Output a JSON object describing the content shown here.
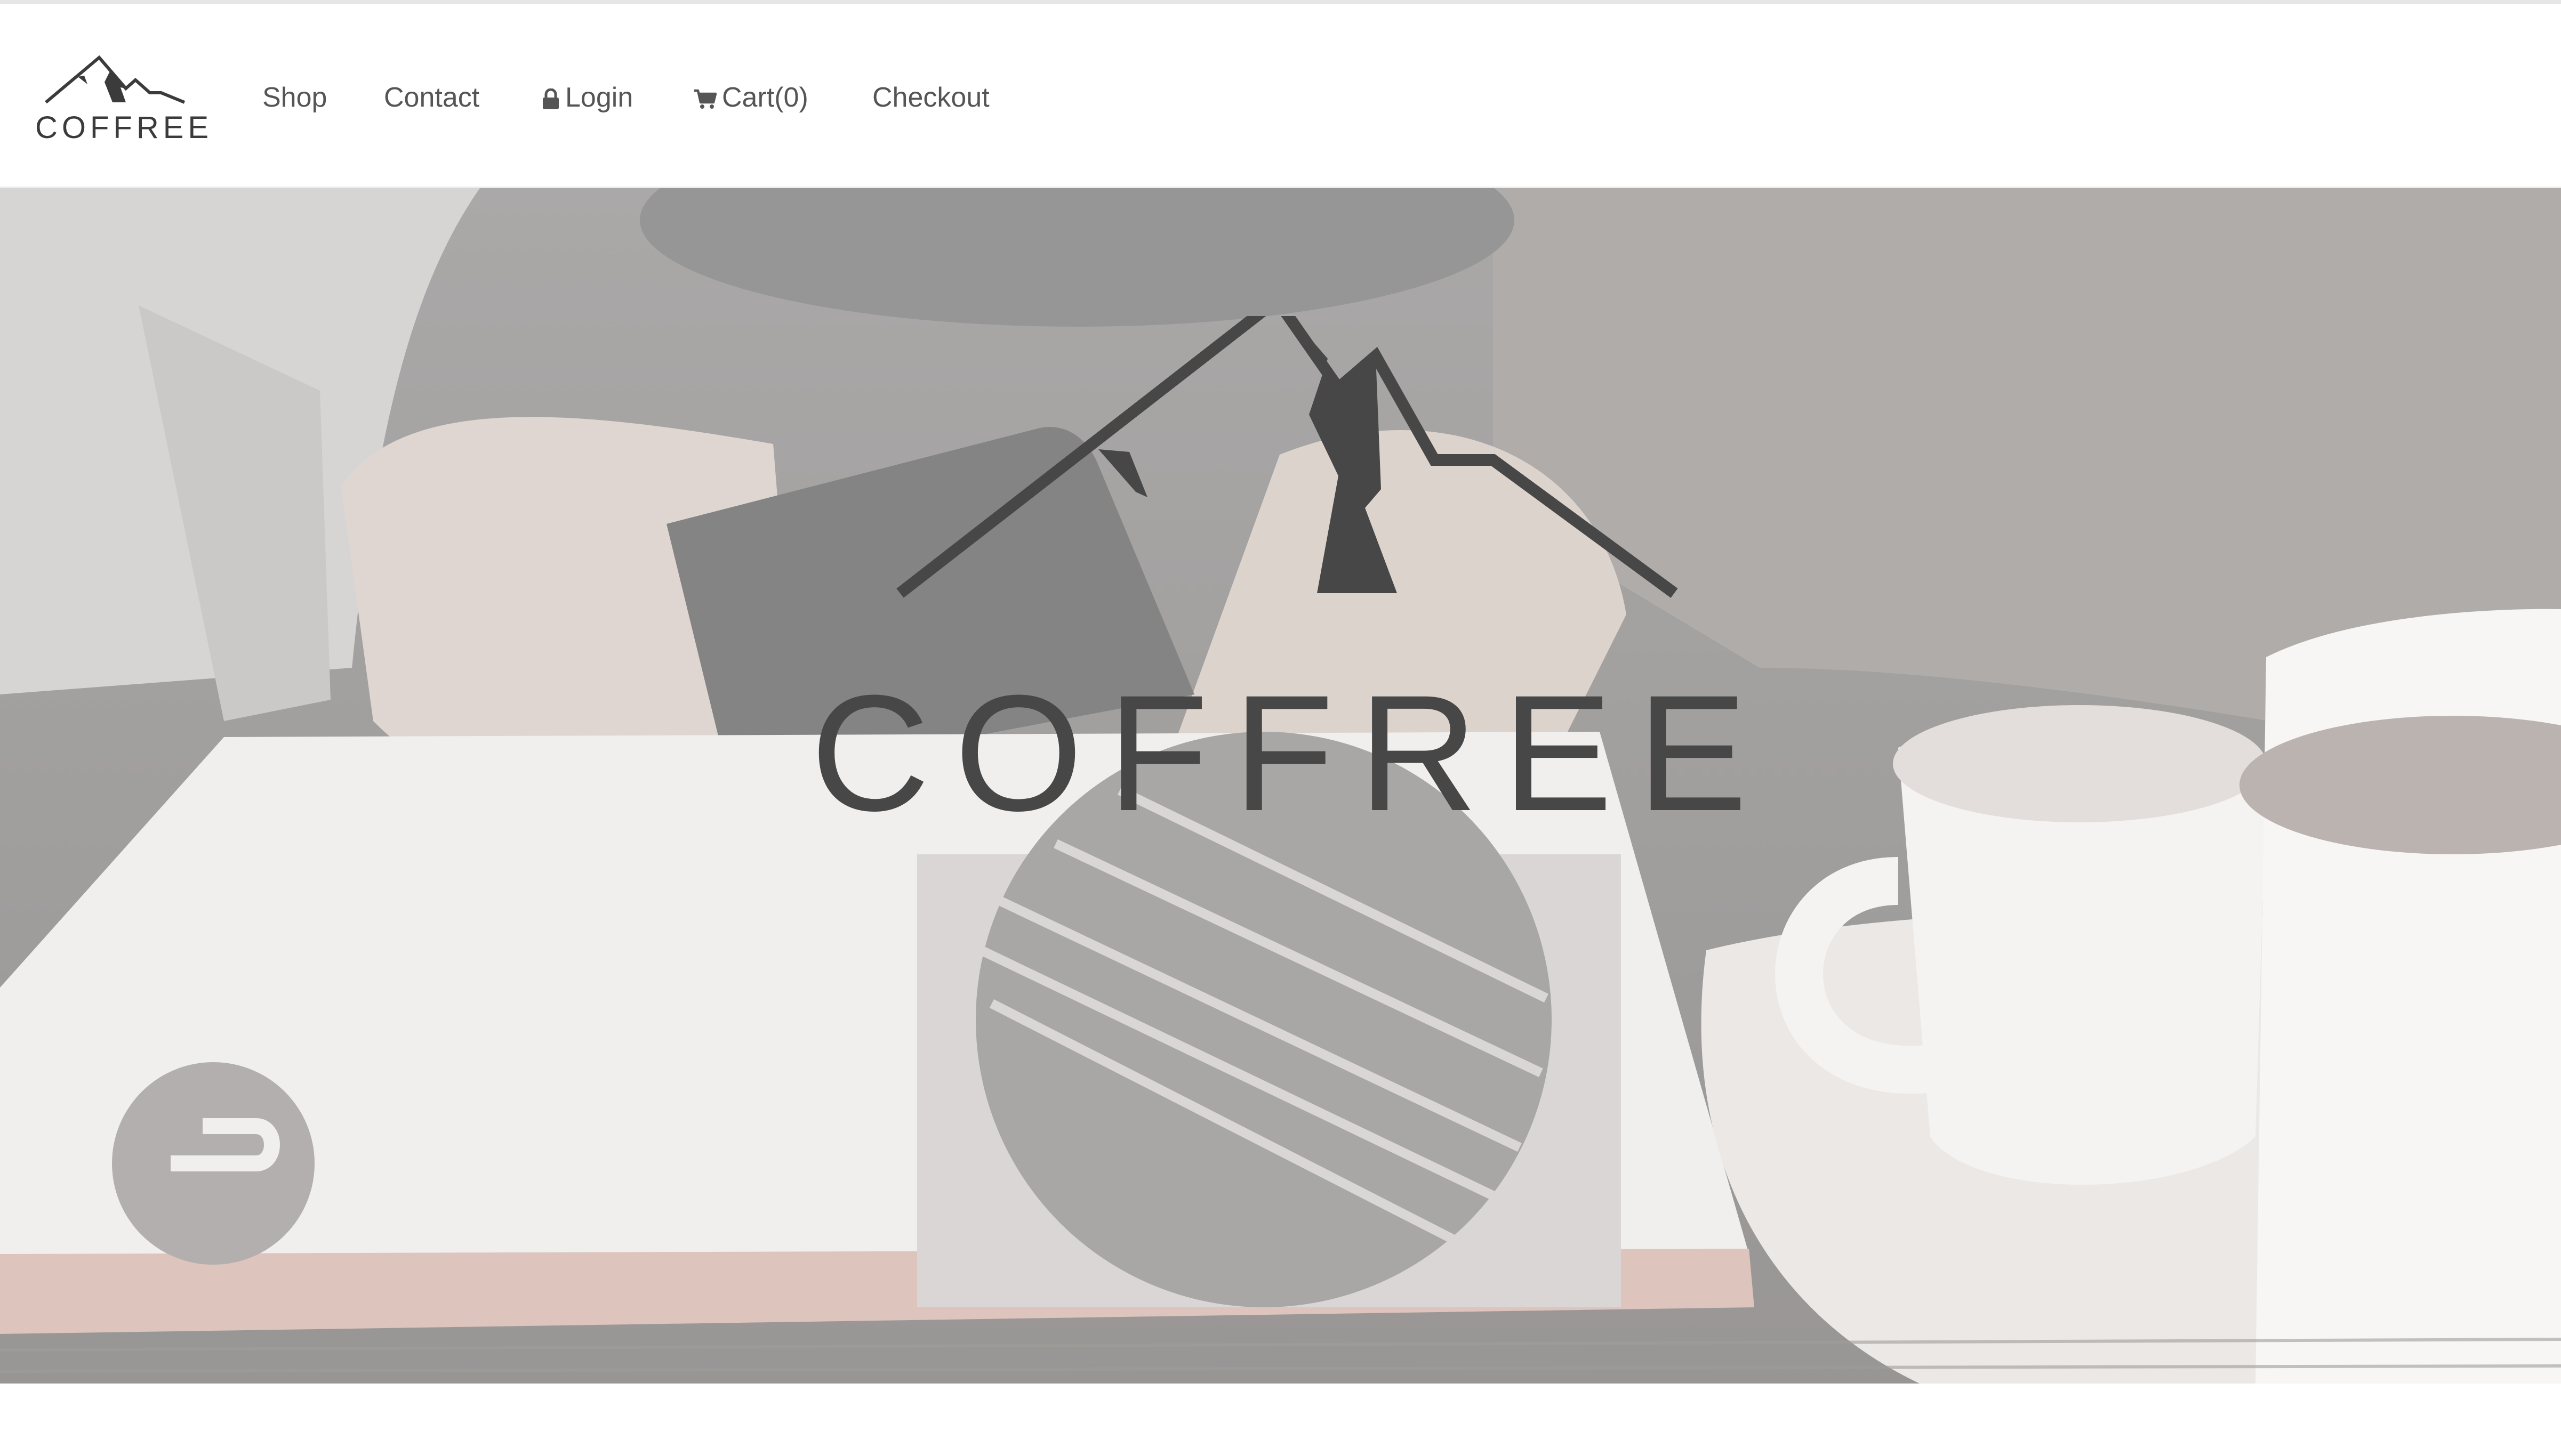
{
  "brand": {
    "name": "COFFREE",
    "logo_icon": "mountain-logo-icon"
  },
  "nav": {
    "items": [
      {
        "label": "Shop",
        "icon": null
      },
      {
        "label": "Contact",
        "icon": null
      },
      {
        "label": "Login",
        "icon": "lock-icon"
      },
      {
        "label": "Cart(0)",
        "icon": "cart-icon"
      },
      {
        "label": "Checkout",
        "icon": null
      }
    ]
  },
  "hero": {
    "title": "COFFREE",
    "logo_icon": "mountain-logo-icon",
    "background": "photo of hands holding phone over magazine with coffee cups"
  },
  "colors": {
    "text": "#555555",
    "logo": "#474747",
    "header_bg": "#ffffff"
  }
}
